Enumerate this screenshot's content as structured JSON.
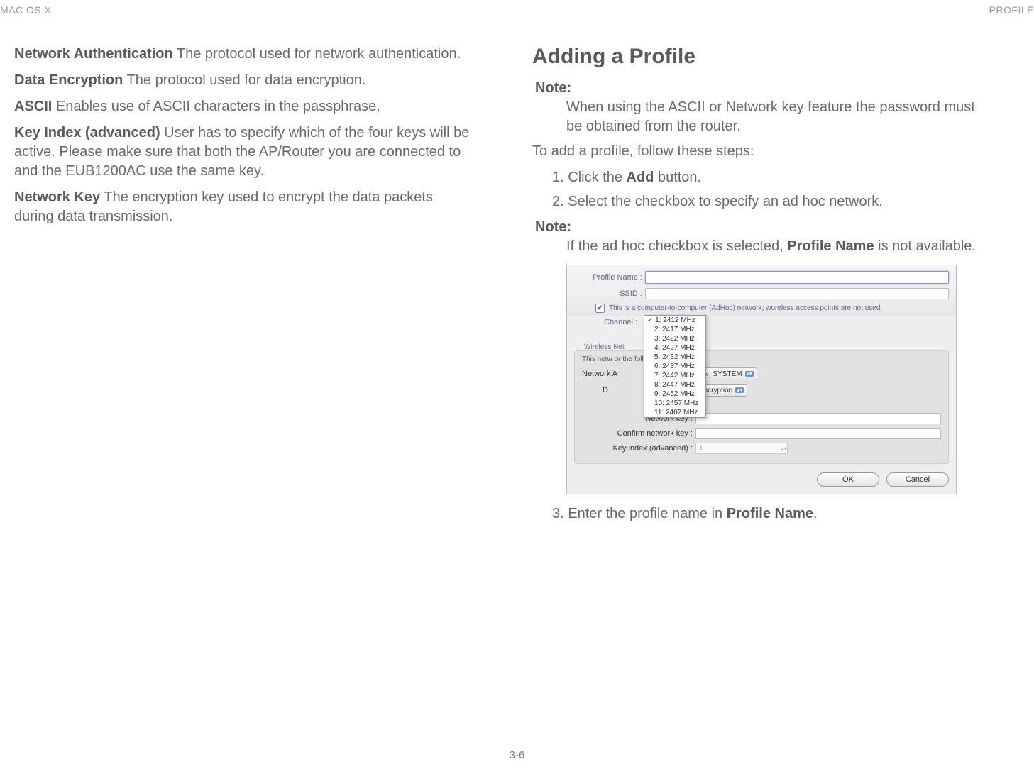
{
  "header": {
    "left": "MAC OS X",
    "right": "PROFILE"
  },
  "left_col": {
    "defs": [
      {
        "term": "Network Authentication",
        "desc": "  The protocol used for network authentication."
      },
      {
        "term": "Data Encryption",
        "desc": "  The protocol used for data encryption."
      },
      {
        "term": "ASCII",
        "desc": "  Enables use of ASCII characters in the passphrase."
      },
      {
        "term": "Key Index (advanced)",
        "desc": "  User has to specify which of the four keys will be active. Please make sure that both the AP/Router you are connected to and the EUB1200AC use the same key."
      },
      {
        "term": "Network Key",
        "desc": "  The encryption key used to encrypt the data packets during data transmission."
      }
    ]
  },
  "right_col": {
    "heading": "Adding a Profile",
    "note1_label": "Note:",
    "note1_body": "When using the ASCII or Network key feature the password must be obtained from the router.",
    "intro": "To add a profile, follow these steps:",
    "steps_a": [
      {
        "num": "1.",
        "pre": "Click the ",
        "bold": "Add",
        "post": " button."
      },
      {
        "num": "2.",
        "pre": "Select the checkbox to specify an ad hoc network.",
        "bold": "",
        "post": ""
      }
    ],
    "note2_label": "Note:",
    "note2_pre": "If the ad hoc checkbox is selected, ",
    "note2_bold": "Profile Name",
    "note2_post": " is not available.",
    "steps_b": [
      {
        "num": "3.",
        "pre": "Enter the profile name in ",
        "bold": "Profile Name",
        "post": "."
      }
    ]
  },
  "screenshot": {
    "profile_name_label": "Profile Name :",
    "ssid_label": "SSID :",
    "adhoc_text": "This is a computer-to-computer (AdHoc) network; woreless access points are not used.",
    "channel_label": "Channel :",
    "wireless_net_label": "Wireless Net",
    "channel_options": [
      "1: 2412 MHz",
      "2: 2417 MHz",
      "3: 2422 MHz",
      "4: 2427 MHz",
      "5: 2432 MHz",
      "6: 2437 MHz",
      "7: 2442 MHz",
      "8: 2447 MHz",
      "9: 2452 MHz",
      "10: 2457 MHz",
      "11: 2462 MHz"
    ],
    "panel_top": "This netw                                 or the following :",
    "network_a_label": "Network A",
    "network_a_value": "EN_SYSTEM",
    "d_label": "D",
    "d_value": "Encryption",
    "network_key_label": "Network key :",
    "confirm_key_label": "Confirm network key :",
    "key_index_label": "Key index (advanced) :",
    "key_index_value": "1",
    "ok": "OK",
    "cancel": "Cancel"
  },
  "footer": "3-6"
}
